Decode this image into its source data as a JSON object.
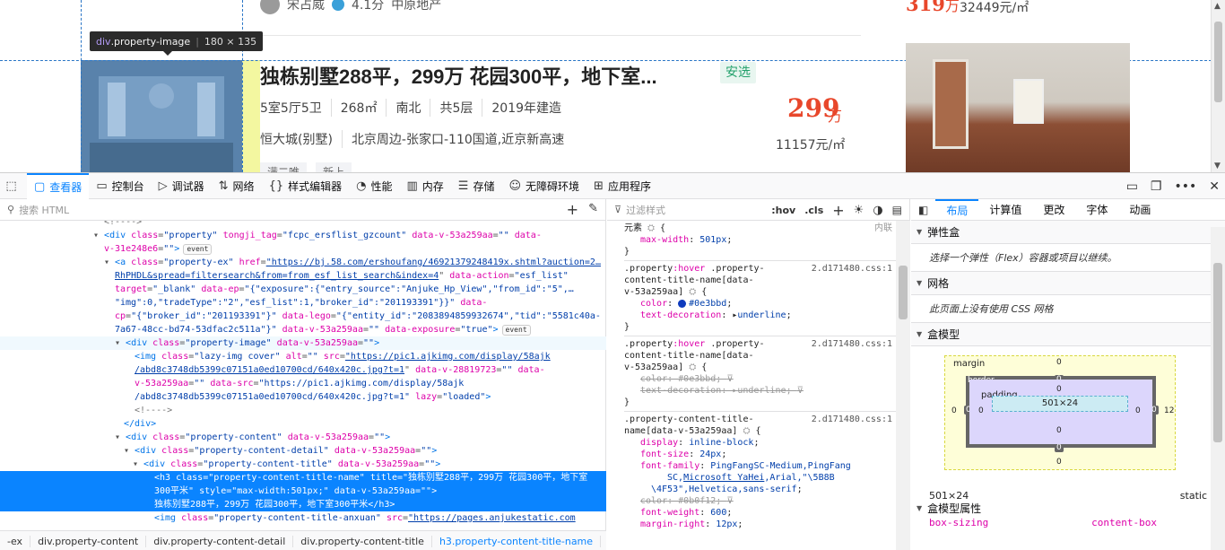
{
  "web": {
    "agent_name": "宋占威",
    "agent_rating": "4.1分",
    "agent_company": "中原地产",
    "prev_price": "319",
    "prev_price_unit": "万",
    "prev_unit_price": "32449元/㎡",
    "tooltip_tag": "div",
    "tooltip_class": ".property-image",
    "tooltip_size": "180 × 135",
    "title": "独栋别墅288平，299万 花园300平，地下室...",
    "badge": "安选",
    "attrs": [
      "5室5厅5卫",
      "268㎡",
      "南北",
      "共5层",
      "2019年建造"
    ],
    "community": "恒大城(别墅)",
    "address": "北京周边-张家口-110国道,近京新高速",
    "price": "299",
    "price_unit": "万",
    "unit_price": "11157元/㎡",
    "tags": [
      "满二唯",
      "新上"
    ]
  },
  "toolbar": {
    "tabs": [
      {
        "label": "查看器",
        "icon": "inspector-icon",
        "active": true
      },
      {
        "label": "控制台",
        "icon": "console-icon"
      },
      {
        "label": "调试器",
        "icon": "debugger-icon"
      },
      {
        "label": "网络",
        "icon": "network-icon"
      },
      {
        "label": "样式编辑器",
        "icon": "style-editor-icon"
      },
      {
        "label": "性能",
        "icon": "performance-icon"
      },
      {
        "label": "内存",
        "icon": "memory-icon"
      },
      {
        "label": "存储",
        "icon": "storage-icon"
      },
      {
        "label": "无障碍环境",
        "icon": "accessibility-icon"
      },
      {
        "label": "应用程序",
        "icon": "application-icon"
      }
    ]
  },
  "inspector": {
    "search_placeholder": "搜索 HTML",
    "breadcrumbs": [
      "-ex",
      "div.property-content",
      "div.property-content-detail",
      "div.property-content-title",
      "h3.property-content-title-name"
    ]
  },
  "rules": {
    "filter_placeholder": "过滤样式",
    "hov": ":hov",
    "cls": ".cls",
    "element_label": "元素",
    "inline_label": "内联",
    "source": "2.d171480.css:1"
  },
  "layout": {
    "tabs": [
      "布局",
      "计算值",
      "更改",
      "字体",
      "动画"
    ],
    "flex_title": "弹性盒",
    "flex_msg": "选择一个弹性（Flex）容器或项目以继续。",
    "grid_title": "网格",
    "grid_msg": "此页面上没有使用 CSS 网格",
    "boxmodel_title": "盒模型",
    "margin_label": "margin",
    "border_label": "border",
    "padding_label": "padding",
    "content_size": "501×24",
    "footer_size": "501×24",
    "footer_position": "static",
    "props_title": "盒模型属性",
    "prop_name": "box-sizing",
    "prop_value": "content-box",
    "margin_right": "12"
  }
}
